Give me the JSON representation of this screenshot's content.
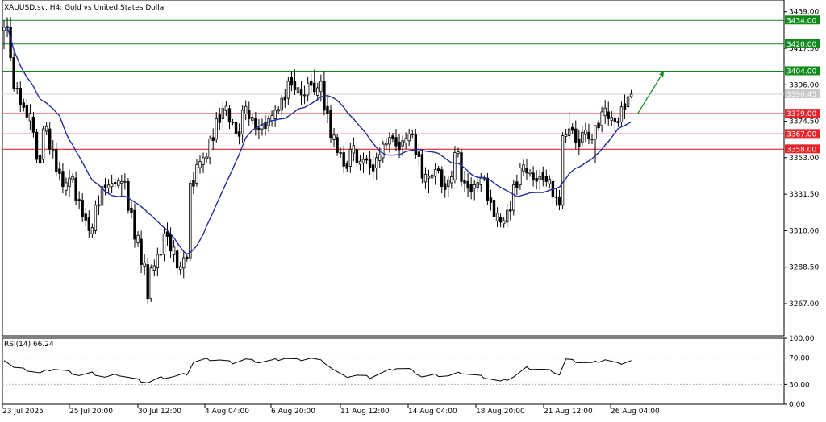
{
  "header": {
    "symbol_title": "XAUUSD.sv, H4:  Gold vs United States Dollar"
  },
  "colors": {
    "background": "#ffffff",
    "frame": "#000000",
    "candle": "#000000",
    "ma_line": "#1f2f9c",
    "support_resistance": "#e8232a",
    "target_level": "#0e8a1a",
    "arrow": "#0e8a1a",
    "current_price_label": "#c8c8c8",
    "rsi_line": "#000000",
    "rsi_level_line": "#b0b0b0"
  },
  "chart_data": [
    {
      "type": "candlestick",
      "title": "XAUUSD.sv, H4:  Gold vs United States Dollar",
      "ylim": [
        3248,
        3446
      ],
      "y_ticks": [
        "3439.00",
        "3417.50",
        "3396.00",
        "3374.50",
        "3353.00",
        "3331.50",
        "3310.00",
        "3288.50",
        "3267.00"
      ],
      "x_tick_labels": [
        "23 Jul 2025",
        "25 Jul 20:00",
        "30 Jul 12:00",
        "4 Aug 04:00",
        "6 Aug 20:00",
        "11 Aug 12:00",
        "14 Aug 04:00",
        "18 Aug 20:00",
        "21 Aug 12:00",
        "26 Aug 04:00"
      ],
      "grid": false,
      "green_levels": [
        {
          "value": 3434.0,
          "label": "3434.00"
        },
        {
          "value": 3420.0,
          "label": "3420.00"
        },
        {
          "value": 3404.0,
          "label": "3404.00"
        }
      ],
      "red_levels": [
        {
          "value": 3379.0,
          "label": "3379.00"
        },
        {
          "value": 3367.0,
          "label": "3367.00"
        },
        {
          "value": 3358.0,
          "label": "3358.00"
        }
      ],
      "current_price": {
        "value": 3390.45,
        "label": "3390.45"
      },
      "arrow_annotation": {
        "from": [
          192,
          3379
        ],
        "to": [
          200,
          3404
        ]
      },
      "ohlc_anchors": [
        [
          0,
          3428,
          3434,
          3417,
          3430
        ],
        [
          2,
          3430,
          3436,
          3410,
          3412
        ],
        [
          3,
          3412,
          3415,
          3392,
          3394
        ],
        [
          5,
          3394,
          3398,
          3380,
          3384
        ],
        [
          7,
          3384,
          3388,
          3375,
          3377
        ],
        [
          9,
          3377,
          3380,
          3365,
          3368
        ],
        [
          10,
          3368,
          3370,
          3350,
          3352
        ],
        [
          12,
          3352,
          3372,
          3350,
          3370
        ],
        [
          14,
          3370,
          3374,
          3355,
          3358
        ],
        [
          16,
          3358,
          3362,
          3342,
          3345
        ],
        [
          18,
          3345,
          3350,
          3332,
          3336
        ],
        [
          20,
          3336,
          3346,
          3330,
          3341
        ],
        [
          22,
          3341,
          3345,
          3325,
          3328
        ],
        [
          24,
          3328,
          3332,
          3315,
          3318
        ],
        [
          26,
          3318,
          3322,
          3306,
          3310
        ],
        [
          28,
          3310,
          3328,
          3308,
          3325
        ],
        [
          30,
          3325,
          3340,
          3320,
          3336
        ],
        [
          33,
          3336,
          3343,
          3332,
          3338
        ],
        [
          36,
          3338,
          3343,
          3330,
          3339
        ],
        [
          38,
          3339,
          3341,
          3320,
          3322
        ],
        [
          40,
          3322,
          3326,
          3300,
          3305
        ],
        [
          42,
          3305,
          3310,
          3285,
          3290
        ],
        [
          44,
          3290,
          3294,
          3267,
          3270
        ],
        [
          45,
          3270,
          3290,
          3268,
          3288
        ],
        [
          47,
          3288,
          3300,
          3283,
          3296
        ],
        [
          49,
          3296,
          3312,
          3292,
          3308
        ],
        [
          51,
          3308,
          3312,
          3294,
          3298
        ],
        [
          53,
          3298,
          3302,
          3284,
          3288
        ],
        [
          55,
          3288,
          3298,
          3282,
          3294
        ],
        [
          57,
          3294,
          3340,
          3292,
          3338
        ],
        [
          59,
          3338,
          3352,
          3336,
          3349
        ],
        [
          61,
          3349,
          3356,
          3344,
          3353
        ],
        [
          63,
          3353,
          3366,
          3349,
          3364
        ],
        [
          65,
          3364,
          3380,
          3362,
          3376
        ],
        [
          67,
          3376,
          3386,
          3370,
          3382
        ],
        [
          69,
          3382,
          3384,
          3370,
          3374
        ],
        [
          71,
          3374,
          3378,
          3364,
          3367
        ],
        [
          73,
          3367,
          3384,
          3362,
          3381
        ],
        [
          75,
          3381,
          3386,
          3372,
          3376
        ],
        [
          77,
          3376,
          3380,
          3366,
          3370
        ],
        [
          79,
          3370,
          3376,
          3366,
          3372
        ],
        [
          81,
          3372,
          3378,
          3368,
          3376
        ],
        [
          83,
          3376,
          3384,
          3371,
          3381
        ],
        [
          85,
          3381,
          3390,
          3378,
          3388
        ],
        [
          87,
          3388,
          3401,
          3384,
          3398
        ],
        [
          89,
          3398,
          3405,
          3390,
          3393
        ],
        [
          91,
          3393,
          3398,
          3384,
          3390
        ],
        [
          93,
          3390,
          3401,
          3386,
          3397
        ],
        [
          95,
          3397,
          3405,
          3390,
          3392
        ],
        [
          97,
          3392,
          3402,
          3386,
          3398
        ],
        [
          98,
          3398,
          3404,
          3378,
          3381
        ],
        [
          100,
          3381,
          3384,
          3362,
          3365
        ],
        [
          102,
          3365,
          3367,
          3354,
          3356
        ],
        [
          104,
          3356,
          3360,
          3344,
          3348
        ],
        [
          106,
          3348,
          3362,
          3344,
          3358
        ],
        [
          108,
          3358,
          3362,
          3346,
          3350
        ],
        [
          110,
          3350,
          3356,
          3344,
          3352
        ],
        [
          112,
          3352,
          3357,
          3343,
          3347
        ],
        [
          114,
          3347,
          3356,
          3340,
          3353
        ],
        [
          116,
          3353,
          3363,
          3350,
          3361
        ],
        [
          118,
          3361,
          3368,
          3356,
          3365
        ],
        [
          120,
          3365,
          3370,
          3357,
          3360
        ],
        [
          122,
          3360,
          3366,
          3354,
          3363
        ],
        [
          124,
          3363,
          3370,
          3360,
          3367
        ],
        [
          126,
          3367,
          3370,
          3352,
          3355
        ],
        [
          128,
          3355,
          3358,
          3338,
          3341
        ],
        [
          130,
          3341,
          3346,
          3332,
          3342
        ],
        [
          132,
          3342,
          3350,
          3337,
          3346
        ],
        [
          134,
          3346,
          3348,
          3332,
          3336
        ],
        [
          136,
          3336,
          3342,
          3330,
          3340
        ],
        [
          138,
          3340,
          3360,
          3338,
          3356
        ],
        [
          140,
          3356,
          3358,
          3336,
          3339
        ],
        [
          142,
          3339,
          3344,
          3330,
          3335
        ],
        [
          144,
          3335,
          3340,
          3328,
          3337
        ],
        [
          146,
          3337,
          3344,
          3333,
          3341
        ],
        [
          148,
          3341,
          3344,
          3325,
          3328
        ],
        [
          150,
          3328,
          3332,
          3314,
          3318
        ],
        [
          152,
          3318,
          3320,
          3312,
          3315
        ],
        [
          154,
          3315,
          3326,
          3312,
          3322
        ],
        [
          156,
          3322,
          3340,
          3319,
          3337
        ],
        [
          158,
          3337,
          3350,
          3334,
          3347
        ],
        [
          160,
          3347,
          3352,
          3340,
          3344
        ],
        [
          162,
          3344,
          3348,
          3336,
          3340
        ],
        [
          164,
          3340,
          3346,
          3334,
          3342
        ],
        [
          166,
          3342,
          3346,
          3336,
          3339
        ],
        [
          168,
          3339,
          3342,
          3326,
          3330
        ],
        [
          170,
          3330,
          3334,
          3322,
          3325
        ],
        [
          171,
          3325,
          3368,
          3323,
          3366
        ],
        [
          173,
          3366,
          3380,
          3364,
          3370
        ],
        [
          175,
          3370,
          3375,
          3358,
          3362
        ],
        [
          177,
          3362,
          3372,
          3360,
          3368
        ],
        [
          179,
          3368,
          3373,
          3361,
          3364
        ],
        [
          181,
          3364,
          3370,
          3350,
          3372
        ],
        [
          183,
          3372,
          3383,
          3368,
          3380
        ],
        [
          185,
          3380,
          3386,
          3372,
          3376
        ],
        [
          187,
          3376,
          3380,
          3368,
          3374
        ],
        [
          189,
          3374,
          3386,
          3372,
          3383
        ],
        [
          191,
          3383,
          3392,
          3380,
          3389
        ],
        [
          192,
          3389,
          3393,
          3388,
          3390.45
        ]
      ]
    },
    {
      "type": "line",
      "title": "RSI(14) 66.24",
      "ylim": [
        0,
        100
      ],
      "y_ticks": [
        "100.00",
        "70.00",
        "30.00",
        "0.00"
      ],
      "level_lines": [
        70,
        30
      ],
      "rsi_anchors": [
        [
          0,
          68
        ],
        [
          3,
          56
        ],
        [
          7,
          52
        ],
        [
          11,
          47
        ],
        [
          15,
          54
        ],
        [
          19,
          50
        ],
        [
          23,
          44
        ],
        [
          27,
          47
        ],
        [
          31,
          41
        ],
        [
          35,
          45
        ],
        [
          40,
          38
        ],
        [
          44,
          33
        ],
        [
          48,
          40
        ],
        [
          52,
          42
        ],
        [
          56,
          46
        ],
        [
          58,
          64
        ],
        [
          62,
          68
        ],
        [
          66,
          67
        ],
        [
          70,
          63
        ],
        [
          74,
          68
        ],
        [
          78,
          64
        ],
        [
          82,
          66
        ],
        [
          86,
          70
        ],
        [
          90,
          67
        ],
        [
          94,
          70
        ],
        [
          98,
          64
        ],
        [
          101,
          52
        ],
        [
          104,
          42
        ],
        [
          108,
          44
        ],
        [
          112,
          41
        ],
        [
          116,
          48
        ],
        [
          120,
          55
        ],
        [
          124,
          53
        ],
        [
          128,
          42
        ],
        [
          132,
          44
        ],
        [
          136,
          43
        ],
        [
          140,
          48
        ],
        [
          144,
          44
        ],
        [
          148,
          40
        ],
        [
          152,
          34
        ],
        [
          156,
          42
        ],
        [
          160,
          55
        ],
        [
          164,
          53
        ],
        [
          168,
          50
        ],
        [
          170,
          45
        ],
        [
          172,
          68
        ],
        [
          176,
          64
        ],
        [
          180,
          62
        ],
        [
          184,
          68
        ],
        [
          188,
          61
        ],
        [
          192,
          66.24
        ]
      ]
    }
  ]
}
